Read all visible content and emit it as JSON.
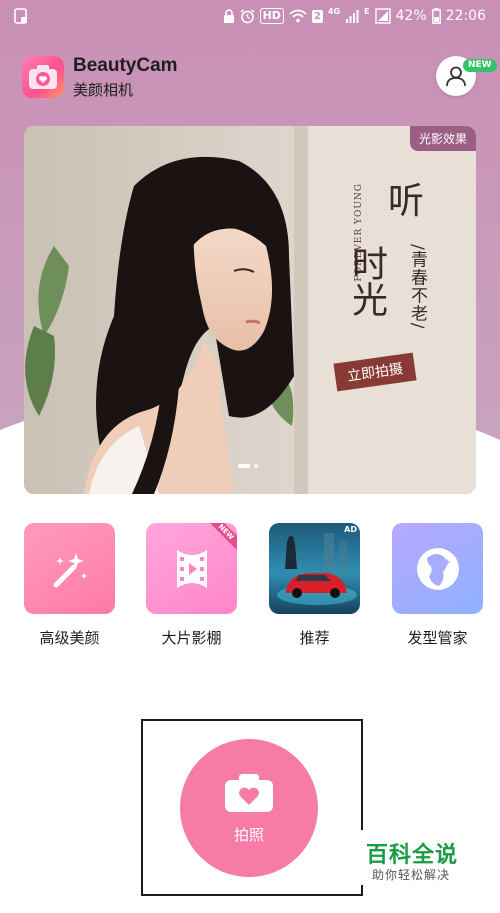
{
  "status_bar": {
    "hd": "HD",
    "sim": "2",
    "net_4g": "4G",
    "net_e": "E",
    "battery": "42%",
    "time": "22:06"
  },
  "header": {
    "app_name": "BeautyCam",
    "app_subtitle": "美颜相机",
    "profile_badge": "NEW"
  },
  "banner": {
    "tag": "光影效果",
    "title_line1": "听",
    "title_line2": "时光",
    "subtitle": "/青春不老/",
    "english": "FOREVER YOUNG",
    "cta": "立即拍摄",
    "page_count": 2,
    "current_page": 1
  },
  "features": [
    {
      "label": "高级美颜",
      "icon": "magic-wand-icon"
    },
    {
      "label": "大片影棚",
      "icon": "film-strip-icon",
      "badge": "NEW"
    },
    {
      "label": "推荐",
      "icon": "car-ad-image",
      "badge": "AD"
    },
    {
      "label": "发型管家",
      "icon": "hair-profile-icon"
    }
  ],
  "capture": {
    "label": "拍照",
    "icon": "camera-heart-icon"
  },
  "watermark": {
    "title": "百科全说",
    "subtitle": "助你轻松解决"
  },
  "colors": {
    "header_bg": "#c99bbb",
    "accent_pink": "#f67ba7",
    "banner_tag": "#9b5f86"
  }
}
